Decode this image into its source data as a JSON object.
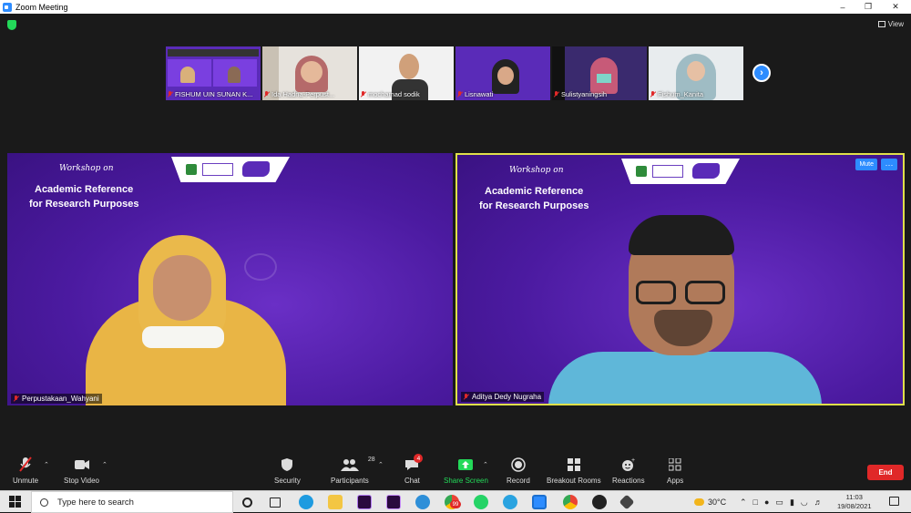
{
  "window": {
    "title": "Zoom Meeting",
    "view_label": "View"
  },
  "strip": [
    {
      "name": "FISHUM UIN SUNAN K..."
    },
    {
      "name": "Ida Hadna-Perpust..."
    },
    {
      "name": "mochamad sodik"
    },
    {
      "name": "Lisnawati"
    },
    {
      "name": "Sulistyaningsih"
    },
    {
      "name": "Fishum_Kanita"
    }
  ],
  "slide": {
    "workshop": "Workshop on",
    "line1": "Academic Reference",
    "line2": "for Research Purposes"
  },
  "main_tiles": [
    {
      "name": "Perpustakaan_Wahyani"
    },
    {
      "name": "Aditya Dedy Nugraha",
      "mute_label": "Mute",
      "more_label": "···"
    }
  ],
  "toolbar": {
    "unmute": "Unmute",
    "stop_video": "Stop Video",
    "security": "Security",
    "participants": "Participants",
    "participants_count": "28",
    "chat": "Chat",
    "chat_badge": "4",
    "share_screen": "Share Screen",
    "record": "Record",
    "breakout": "Breakout Rooms",
    "reactions": "Reactions",
    "apps": "Apps",
    "end": "End"
  },
  "taskbar": {
    "search_placeholder": "Type here to search",
    "weather": "30°C",
    "time": "11:03",
    "date": "19/08/2021",
    "chrome_badge": "99"
  },
  "colors": {
    "accent": "#2d8cff",
    "end": "#e02828",
    "share": "#23d959",
    "active_border": "#e0e04a"
  }
}
